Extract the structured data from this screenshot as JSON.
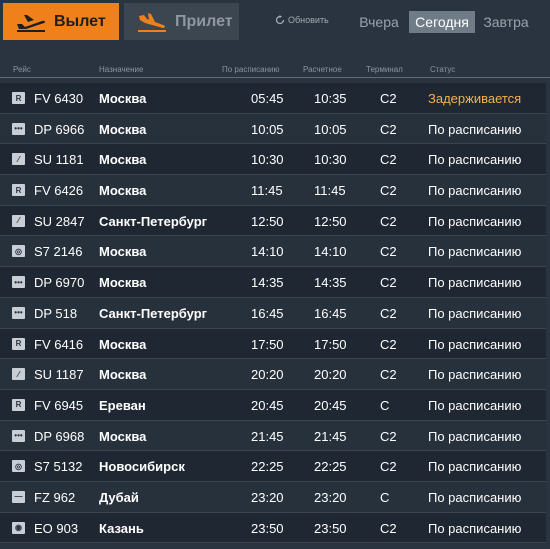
{
  "tabs": {
    "departures_label": "Вылет",
    "arrivals_label": "Прилет"
  },
  "refresh_label": "Обновить",
  "days": {
    "yesterday": "Вчера",
    "today": "Сегодня",
    "tomorrow": "Завтра"
  },
  "columns": {
    "flight": "Рейс",
    "destination": "Назначение",
    "scheduled": "По расписанию",
    "estimated": "Расчетное",
    "terminal": "Терминал",
    "status": "Статус"
  },
  "flights": [
    {
      "flight": "FV 6430",
      "destination": "Москва",
      "scheduled": "05:45",
      "estimated": "10:35",
      "terminal": "C2",
      "status": "Задерживается",
      "logo": "R"
    },
    {
      "flight": "DP 6966",
      "destination": "Москва",
      "scheduled": "10:05",
      "estimated": "10:05",
      "terminal": "C2",
      "status": "По расписанию",
      "logo": "•••"
    },
    {
      "flight": "SU 1181",
      "destination": "Москва",
      "scheduled": "10:30",
      "estimated": "10:30",
      "terminal": "C2",
      "status": "По расписанию",
      "logo": "⁄"
    },
    {
      "flight": "FV 6426",
      "destination": "Москва",
      "scheduled": "11:45",
      "estimated": "11:45",
      "terminal": "C2",
      "status": "По расписанию",
      "logo": "R"
    },
    {
      "flight": "SU 2847",
      "destination": "Санкт-Петербург",
      "scheduled": "12:50",
      "estimated": "12:50",
      "terminal": "C2",
      "status": "По расписанию",
      "logo": "⁄"
    },
    {
      "flight": "S7 2146",
      "destination": "Москва",
      "scheduled": "14:10",
      "estimated": "14:10",
      "terminal": "C2",
      "status": "По расписанию",
      "logo": "◎"
    },
    {
      "flight": "DP 6970",
      "destination": "Москва",
      "scheduled": "14:35",
      "estimated": "14:35",
      "terminal": "C2",
      "status": "По расписанию",
      "logo": "•••"
    },
    {
      "flight": "DP 518",
      "destination": "Санкт-Петербург",
      "scheduled": "16:45",
      "estimated": "16:45",
      "terminal": "C2",
      "status": "По расписанию",
      "logo": "•••"
    },
    {
      "flight": "FV 6416",
      "destination": "Москва",
      "scheduled": "17:50",
      "estimated": "17:50",
      "terminal": "C2",
      "status": "По расписанию",
      "logo": "R"
    },
    {
      "flight": "SU 1187",
      "destination": "Москва",
      "scheduled": "20:20",
      "estimated": "20:20",
      "terminal": "C2",
      "status": "По расписанию",
      "logo": "⁄"
    },
    {
      "flight": "FV 6945",
      "destination": "Ереван",
      "scheduled": "20:45",
      "estimated": "20:45",
      "terminal": "C",
      "status": "По расписанию",
      "logo": "R"
    },
    {
      "flight": "DP 6968",
      "destination": "Москва",
      "scheduled": "21:45",
      "estimated": "21:45",
      "terminal": "C2",
      "status": "По расписанию",
      "logo": "•••"
    },
    {
      "flight": "S7 5132",
      "destination": "Новосибирск",
      "scheduled": "22:25",
      "estimated": "22:25",
      "terminal": "C2",
      "status": "По расписанию",
      "logo": "◎"
    },
    {
      "flight": "FZ 962",
      "destination": "Дубай",
      "scheduled": "23:20",
      "estimated": "23:20",
      "terminal": "C",
      "status": "По расписанию",
      "logo": "—"
    },
    {
      "flight": "EO 903",
      "destination": "Казань",
      "scheduled": "23:50",
      "estimated": "23:50",
      "terminal": "C2",
      "status": "По расписанию",
      "logo": "◉"
    }
  ],
  "colors": {
    "accent": "#f08019",
    "delayed": "#f3b24a"
  },
  "icons": {
    "departures": "plane-takeoff-icon",
    "arrivals": "plane-landing-icon",
    "refresh": "refresh-icon"
  }
}
